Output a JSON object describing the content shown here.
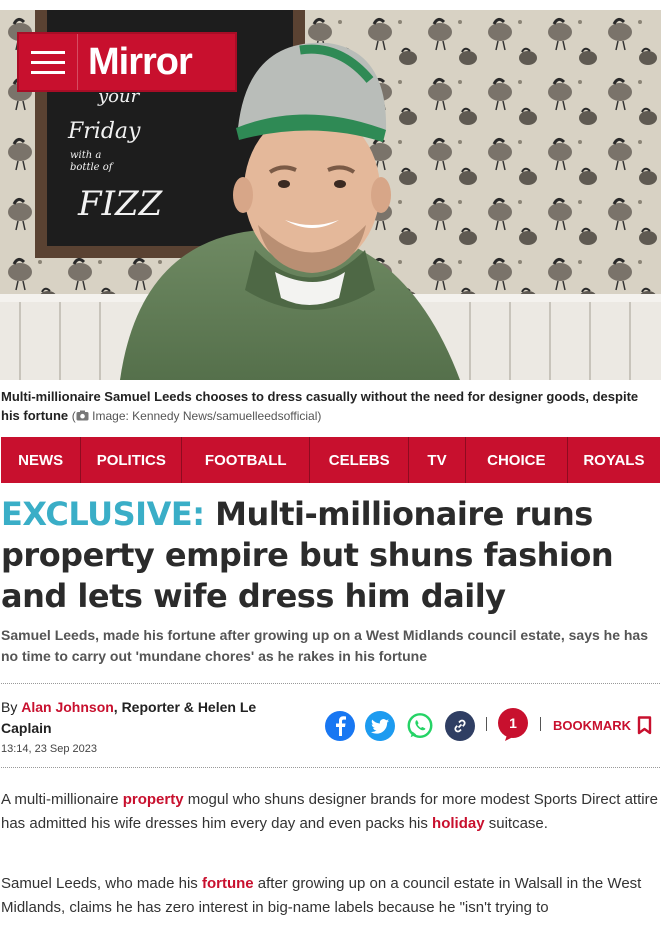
{
  "header": {
    "logo": "Mirror"
  },
  "hero": {
    "chalkboard_lines": [
      "your",
      "Friday",
      "with a",
      "bottle of",
      "FIZZ"
    ]
  },
  "caption": {
    "text": "Multi-millionaire Samuel Leeds chooses to dress casually without the need for designer goods, despite his fortune",
    "credit": "Image: Kennedy News/samuelleedsofficial"
  },
  "nav": {
    "items": [
      "NEWS",
      "POLITICS",
      "FOOTBALL",
      "CELEBS",
      "TV",
      "CHOICE",
      "ROYALS"
    ]
  },
  "article": {
    "exclusive_label": "EXCLUSIVE:",
    "headline": " Multi-millionaire runs property empire but shuns fashion and lets wife dress him daily",
    "standfirst": "Samuel Leeds, made his fortune after growing up on a West Midlands council estate, says he has no time to carry out 'mundane chores' as he rakes in his fortune",
    "byline_prefix": "By ",
    "author1": "Alan Johnson",
    "author1_role": ", Reporter & ",
    "author2": "Helen Le Caplain",
    "timestamp": "13:14, 23 Sep 2023",
    "comment_count": "1",
    "bookmark_label": "BOOKMARK",
    "para1_a": "A multi-millionaire ",
    "para1_link1": "property",
    "para1_b": " mogul who shuns designer brands for more modest Sports Direct attire has admitted his wife dresses him every day and even packs his ",
    "para1_link2": "holiday",
    "para1_c": " suitcase.",
    "para2_a": "Samuel Leeds, who made his ",
    "para2_link1": "fortune",
    "para2_b": " after growing up on a council estate in Walsall in the West Midlands, claims he has zero interest in big-name labels because he \"isn't trying to"
  },
  "colors": {
    "brand_red": "#c8102e",
    "exclusive_teal": "#3aaec7",
    "facebook": "#1877f2",
    "twitter": "#1d9bf0",
    "whatsapp": "#25d366",
    "link_icon": "#2f3e63"
  },
  "icons": {
    "menu": "hamburger-icon",
    "camera": "camera-icon",
    "facebook": "facebook-icon",
    "twitter": "twitter-icon",
    "whatsapp": "whatsapp-icon",
    "copy_link": "link-icon",
    "comments": "comment-bubble-icon",
    "bookmark": "bookmark-icon"
  }
}
